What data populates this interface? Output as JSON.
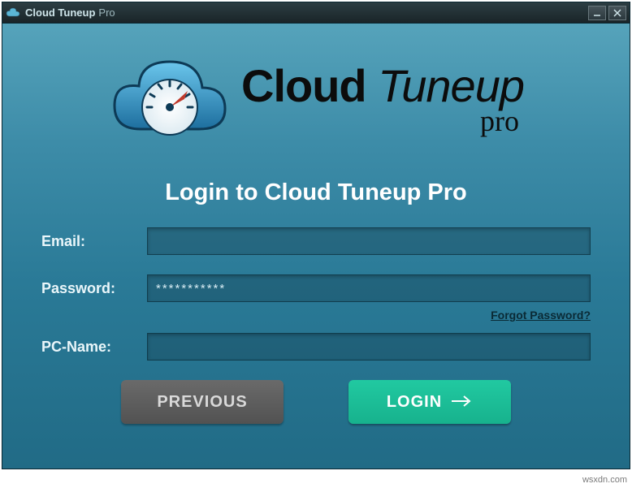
{
  "titlebar": {
    "app_name": "Cloud Tuneup",
    "app_suffix": "Pro"
  },
  "logo": {
    "word1": "Cloud ",
    "word2": "Tuneup",
    "sub": "pro"
  },
  "heading": "Login to Cloud Tuneup Pro",
  "form": {
    "email_label": "Email:",
    "email_value": "",
    "password_label": "Password:",
    "password_value": "***********",
    "pcname_label": "PC-Name:",
    "pcname_value": "",
    "forgot": "Forgot Password?"
  },
  "buttons": {
    "previous": "PREVIOUS",
    "login": "LOGIN"
  },
  "watermark": "wsxdn.com"
}
